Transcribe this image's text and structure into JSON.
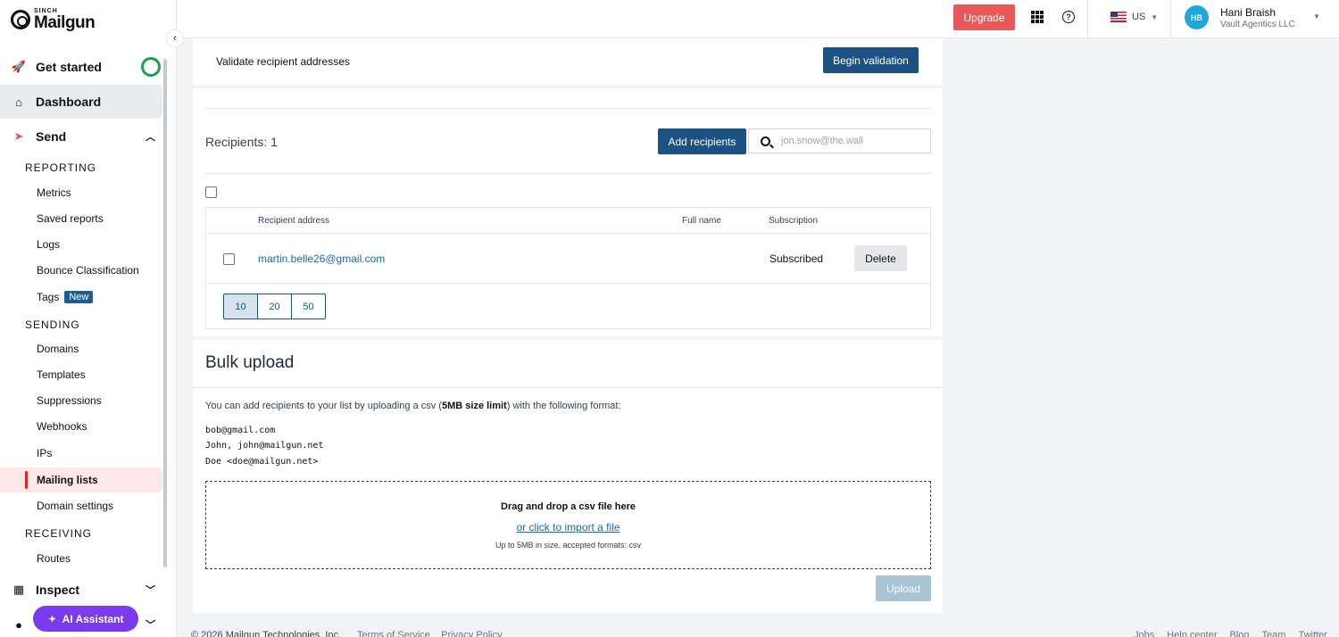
{
  "brand": {
    "sinch": "SINCH",
    "name": "Mailgun"
  },
  "header": {
    "upgrade_label": "Upgrade",
    "region": "US",
    "user": {
      "initials": "HB",
      "name": "Hani Braish",
      "org": "Vault Agentics LLC"
    }
  },
  "sidebar": {
    "get_started": "Get started",
    "dashboard": "Dashboard",
    "send": "Send",
    "reporting_header": "REPORTING",
    "reporting": [
      "Metrics",
      "Saved reports",
      "Logs",
      "Bounce Classification",
      "Tags"
    ],
    "tags_badge": "New",
    "sending_header": "SENDING",
    "sending": [
      "Domains",
      "Templates",
      "Suppressions",
      "Webhooks",
      "IPs",
      "Mailing lists",
      "Domain settings"
    ],
    "receiving_header": "RECEIVING",
    "receiving": [
      "Routes"
    ],
    "inspect": "Inspect",
    "ai_assistant": "AI Assistant"
  },
  "validate": {
    "title": "Validate recipient addresses",
    "button": "Begin validation"
  },
  "recipients": {
    "count_label": "Recipients: 1",
    "add_button": "Add recipients",
    "search_placeholder": "jon.snow@the.wall",
    "columns": [
      "Recipient address",
      "Full name",
      "Subscription"
    ],
    "rows": [
      {
        "address": "martin.belle26@gmail.com",
        "full_name": "",
        "subscription": "Subscribed",
        "action": "Delete"
      }
    ],
    "page_sizes": [
      "10",
      "20",
      "50"
    ]
  },
  "bulk": {
    "title": "Bulk upload",
    "desc_pre": "You can add recipients to your list by uploading a csv (",
    "desc_bold": "5MB size limit",
    "desc_post": ") with the following format:",
    "examples": [
      "bob@gmail.com",
      "John, john@mailgun.net",
      "Doe <doe@mailgun.net>"
    ],
    "drop_title": "Drag and drop a csv file here",
    "drop_link": "or click to import a file",
    "drop_note": "Up to 5MB in size, accepted formats: csv",
    "upload_button": "Upload"
  },
  "footer": {
    "copyright": "© 2026 Mailgun Technologies, Inc.",
    "links": [
      "Terms of Service",
      "Privacy Policy"
    ],
    "right_links": [
      "Jobs",
      "Help center",
      "Blog",
      "Team",
      "Twitter"
    ]
  }
}
